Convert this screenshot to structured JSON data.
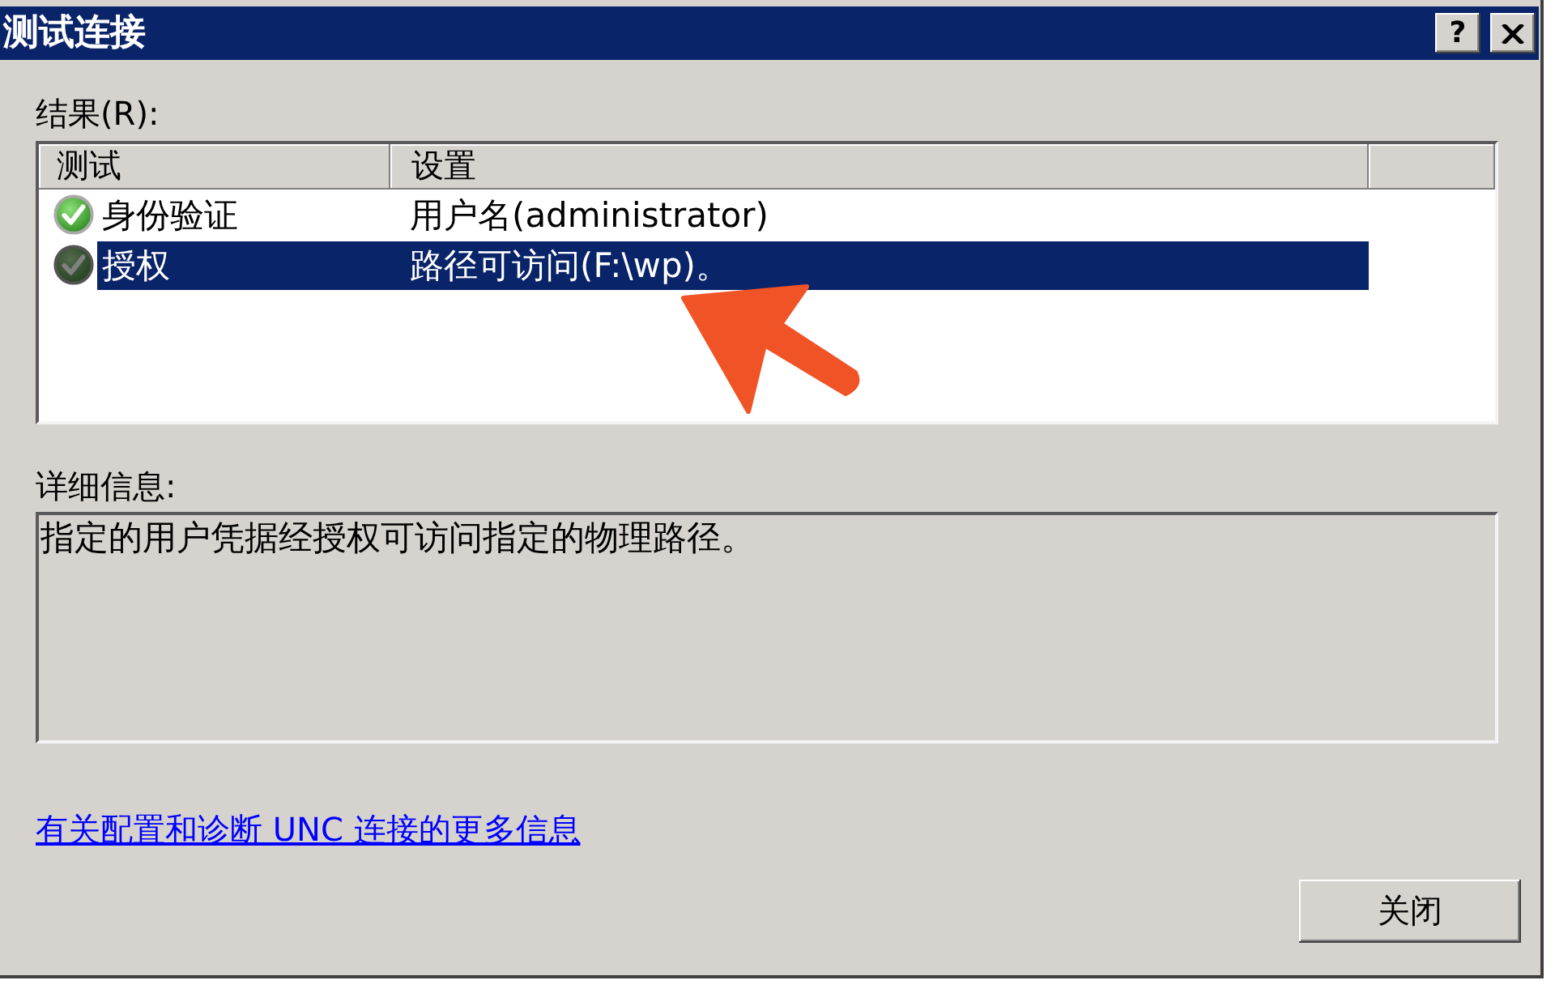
{
  "window": {
    "title": "测试连接",
    "title_buttons": [
      {
        "kind": "help",
        "label": "?"
      },
      {
        "kind": "close"
      }
    ]
  },
  "results": {
    "label": "结果(R):",
    "columns": [
      "测试",
      "设置"
    ],
    "rows": [
      {
        "test": "身份验证",
        "setting": "用户名(administrator)",
        "selected": false
      },
      {
        "test": "授权",
        "setting": "路径可访问(F:\\wp)。",
        "selected": true
      }
    ]
  },
  "details": {
    "label": "详细信息:",
    "text": "指定的用户凭据经授权可访问指定的物理路径。"
  },
  "link": "有关配置和诊断 UNC 连接的更多信息",
  "buttons": [
    {
      "label": "关闭"
    }
  ]
}
